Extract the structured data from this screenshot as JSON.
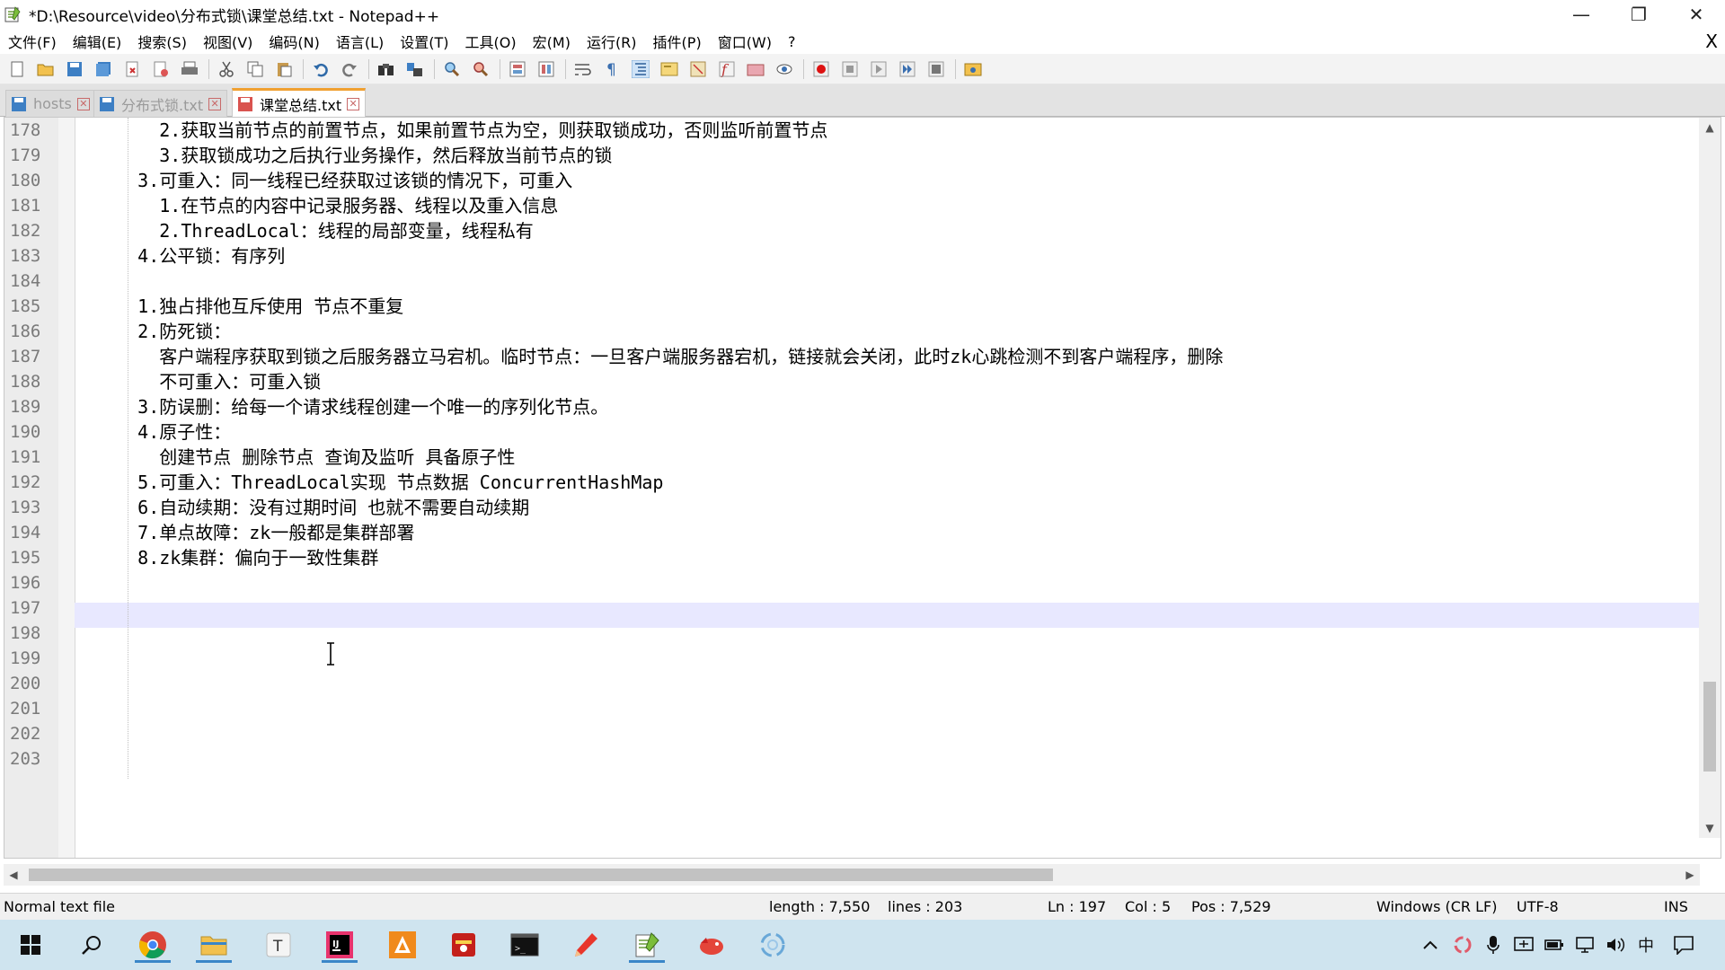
{
  "window": {
    "title": "*D:\\Resource\\video\\分布式锁\\课堂总结.txt - Notepad++",
    "minimize_glyph": "—",
    "maximize_glyph": "❐",
    "close_glyph": "✕"
  },
  "menu": {
    "items": [
      "文件(F)",
      "编辑(E)",
      "搜索(S)",
      "视图(V)",
      "编码(N)",
      "语言(L)",
      "设置(T)",
      "工具(O)",
      "宏(M)",
      "运行(R)",
      "插件(P)",
      "窗口(W)",
      "?"
    ],
    "close_glyph": "X"
  },
  "tabs": [
    {
      "label": "hosts",
      "active": false
    },
    {
      "label": "分布式锁.txt",
      "active": false
    },
    {
      "label": "课堂总结.txt",
      "active": true
    }
  ],
  "editor": {
    "line_numbers": [
      "178",
      "179",
      "180",
      "181",
      "182",
      "183",
      "184",
      "185",
      "186",
      "187",
      "188",
      "189",
      "190",
      "191",
      "192",
      "193",
      "194",
      "195",
      "196",
      "197",
      "198",
      "199",
      "200",
      "201",
      "202",
      "203"
    ],
    "lines": [
      "      2.获取当前节点的前置节点，如果前置节点为空，则获取锁成功，否则监听前置节点",
      "      3.获取锁成功之后执行业务操作，然后释放当前节点的锁",
      "    3.可重入：同一线程已经获取过该锁的情况下，可重入",
      "      1.在节点的内容中记录服务器、线程以及重入信息",
      "      2.ThreadLocal：线程的局部变量，线程私有",
      "    4.公平锁：有序列",
      "",
      "    1.独占排他互斥使用 节点不重复",
      "    2.防死锁：",
      "      客户端程序获取到锁之后服务器立马宕机。临时节点：一旦客户端服务器宕机，链接就会关闭，此时zk心跳检测不到客户端程序，删除",
      "      不可重入：可重入锁",
      "    3.防误删：给每一个请求线程创建一个唯一的序列化节点。",
      "    4.原子性：",
      "      创建节点 删除节点 查询及监听 具备原子性",
      "    5.可重入：ThreadLocal实现 节点数据 ConcurrentHashMap",
      "    6.自动续期：没有过期时间 也就不需要自动续期",
      "    7.单点故障：zk一般都是集群部署",
      "    8.zk集群：偏向于一致性集群",
      "",
      "",
      "",
      "",
      "",
      "",
      "",
      ""
    ],
    "current_line_index": 19
  },
  "status": {
    "file_type": "Normal text file",
    "length": "length : 7,550",
    "lines": "lines : 203",
    "ln": "Ln : 197",
    "col": "Col : 5",
    "pos": "Pos : 7,529",
    "eol": "Windows (CR LF)",
    "encoding": "UTF-8",
    "mode": "INS"
  },
  "taskbar": {
    "apps": [
      "windows-start",
      "search",
      "chrome",
      "file-explorer",
      "typora",
      "intellij",
      "app-orange",
      "app-red",
      "terminal",
      "pen-app",
      "notepad-plus-plus",
      "app-redbird",
      "app-swirl"
    ],
    "tray_ime": "中"
  },
  "colors": {
    "current_line": "#e8e8ff",
    "active_tab_accent": "#f0a030",
    "taskbar": "#cfe4ef"
  }
}
